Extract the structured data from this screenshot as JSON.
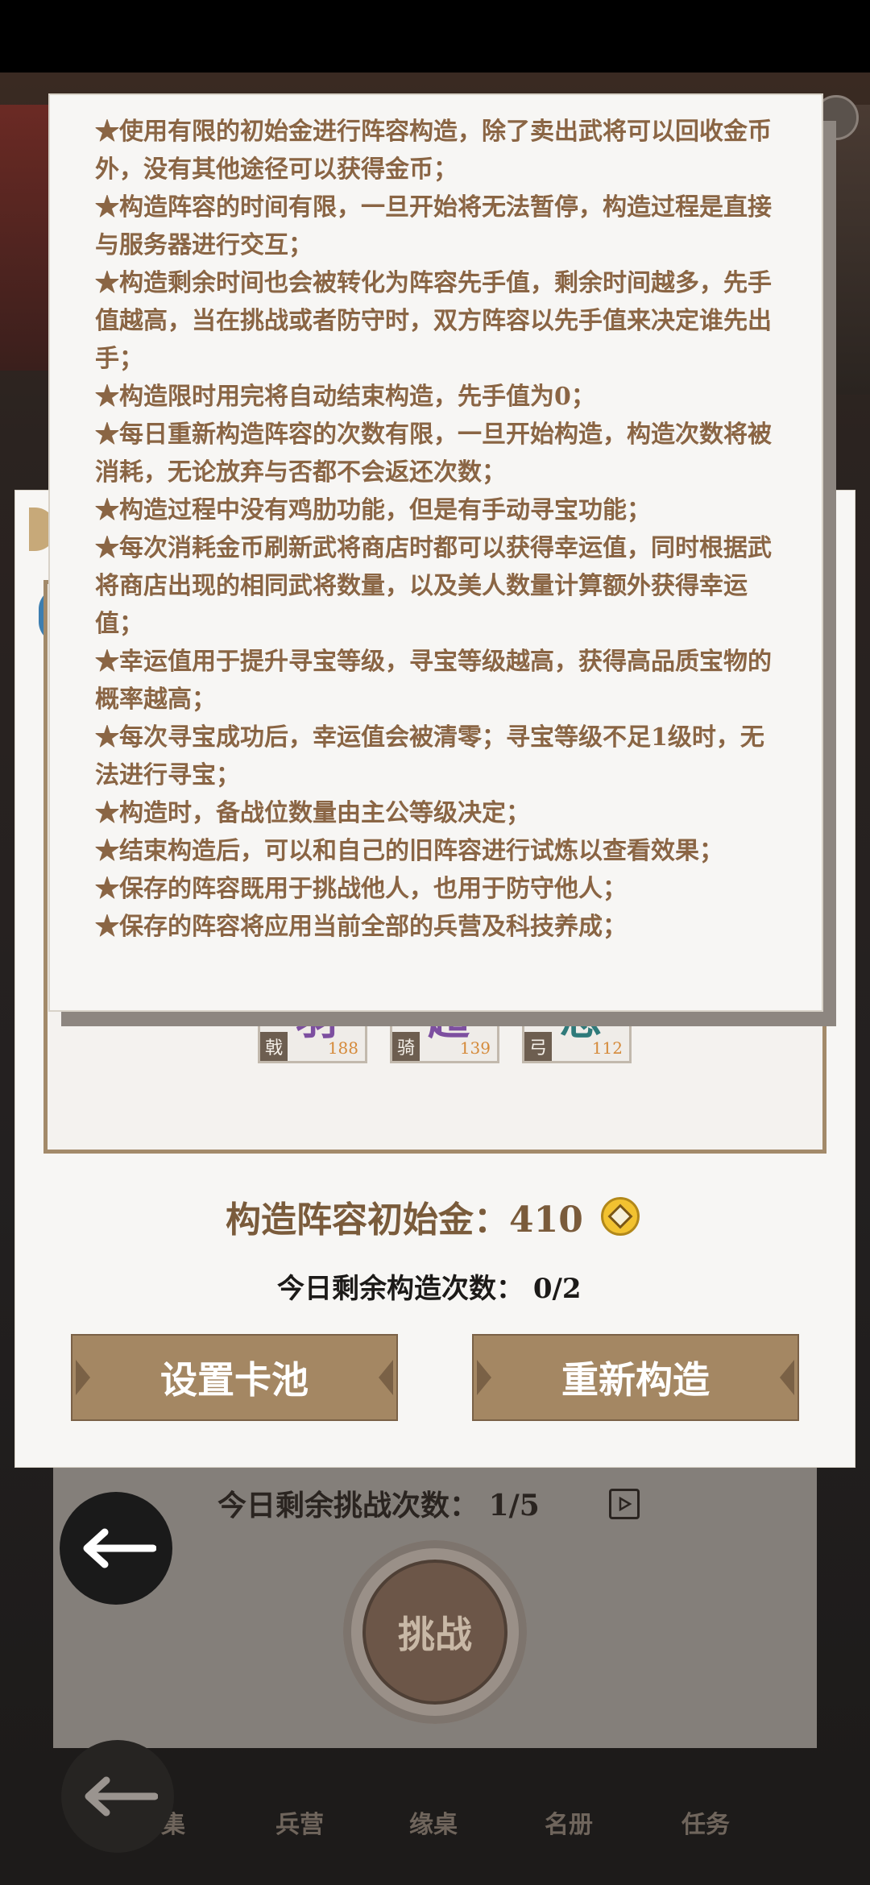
{
  "rules": [
    "★使用有限的初始金进行阵容构造，除了卖出武将可以回收金币外，没有其他途径可以获得金币；",
    "★构造阵容的时间有限，一旦开始将无法暂停，构造过程是直接与服务器进行交互；",
    "★构造剩余时间也会被转化为阵容先手值，剩余时间越多，先手值越高，当在挑战或者防守时，双方阵容以先手值来决定谁先出手；",
    "★构造限时用完将自动结束构造，先手值为0；",
    "★每日重新构造阵容的次数有限，一旦开始构造，构造次数将被消耗，无论放弃与否都不会返还次数；",
    "★构造过程中没有鸡肋功能，但是有手动寻宝功能；",
    "★每次消耗金币刷新武将商店时都可以获得幸运值，同时根据武将商店出现的相同武将数量，以及美人数量计算额外获得幸运值；",
    "★幸运值用于提升寻宝等级，寻宝等级越高，获得高品质宝物的概率越高；",
    "★每次寻宝成功后，幸运值会被清零；寻宝等级不足1级时，无法进行寻宝；",
    "★构造时，备战位数量由主公等级决定；",
    "★结束构造后，可以和自己的旧阵容进行试炼以查看效果；",
    "★保存的阵容既用于挑战他人，也用于防守他人；",
    "★保存的阵容将应用当前全部的兵营及科技养成；"
  ],
  "heroes": [
    {
      "glyph": "羽",
      "type": "戟",
      "power": "188",
      "color": "#7d4fa0"
    },
    {
      "glyph": "超",
      "type": "骑",
      "power": "139",
      "color": "#7d4fa0"
    },
    {
      "glyph": "忠",
      "type": "弓",
      "power": "112",
      "color": "#2f7a7a"
    }
  ],
  "build": {
    "gold_label": "构造阵容初始金：",
    "gold_value": "410",
    "count_label": "今日剩余构造次数：",
    "count_value": "0/2",
    "set_pool_label": "设置卡池",
    "rebuild_label": "重新构造"
  },
  "challenge": {
    "count_label": "今日剩余挑战次数：",
    "count_value": "1/5",
    "button_label": "挑战"
  },
  "nav": [
    "集",
    "兵营",
    "缘桌",
    "名册",
    "任务"
  ],
  "colors": {
    "rules_text": "#8a6544",
    "button_bg": "#a48763",
    "coin": "#f2c230"
  }
}
